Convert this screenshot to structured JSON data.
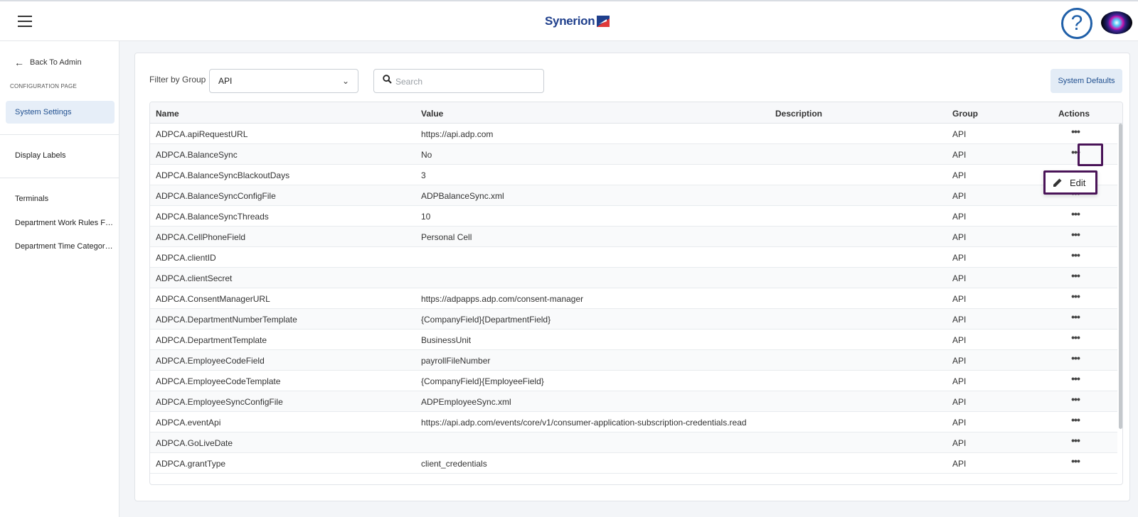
{
  "header": {
    "logo_text": "Synerion",
    "help_symbol": "?"
  },
  "sidebar": {
    "back_label": "Back To Admin",
    "section_label": "CONFIGURATION PAGE",
    "items": [
      {
        "label": "System Settings"
      },
      {
        "label": "Display Labels"
      },
      {
        "label": "Terminals"
      },
      {
        "label": "Department Work Rules Filt..."
      },
      {
        "label": "Department Time Category ..."
      }
    ]
  },
  "toolbar": {
    "filter_label": "Filter by Group",
    "filter_value": "API",
    "search_placeholder": "Search",
    "system_defaults_label": "System Defaults"
  },
  "table": {
    "columns": [
      "Name",
      "Value",
      "Description",
      "Group",
      "Actions"
    ],
    "rows": [
      {
        "name": "ADPCA.apiRequestURL",
        "value": "https://api.adp.com",
        "description": "",
        "group": "API"
      },
      {
        "name": "ADPCA.BalanceSync",
        "value": "No",
        "description": "",
        "group": "API"
      },
      {
        "name": "ADPCA.BalanceSyncBlackoutDays",
        "value": "3",
        "description": "",
        "group": "API"
      },
      {
        "name": "ADPCA.BalanceSyncConfigFile",
        "value": "ADPBalanceSync.xml",
        "description": "",
        "group": "API"
      },
      {
        "name": "ADPCA.BalanceSyncThreads",
        "value": "10",
        "description": "",
        "group": "API"
      },
      {
        "name": "ADPCA.CellPhoneField",
        "value": "Personal Cell",
        "description": "",
        "group": "API"
      },
      {
        "name": "ADPCA.clientID",
        "value": "",
        "description": "",
        "group": "API"
      },
      {
        "name": "ADPCA.clientSecret",
        "value": "",
        "description": "",
        "group": "API"
      },
      {
        "name": "ADPCA.ConsentManagerURL",
        "value": "https://adpapps.adp.com/consent-manager",
        "description": "",
        "group": "API"
      },
      {
        "name": "ADPCA.DepartmentNumberTemplate",
        "value": "{CompanyField}{DepartmentField}",
        "description": "",
        "group": "API"
      },
      {
        "name": "ADPCA.DepartmentTemplate",
        "value": "BusinessUnit",
        "description": "",
        "group": "API"
      },
      {
        "name": "ADPCA.EmployeeCodeField",
        "value": "payrollFileNumber",
        "description": "",
        "group": "API"
      },
      {
        "name": "ADPCA.EmployeeCodeTemplate",
        "value": "{CompanyField}{EmployeeField}",
        "description": "",
        "group": "API"
      },
      {
        "name": "ADPCA.EmployeeSyncConfigFile",
        "value": "ADPEmployeeSync.xml",
        "description": "",
        "group": "API"
      },
      {
        "name": "ADPCA.eventApi",
        "value": "https://api.adp.com/events/core/v1/consumer-application-subscription-credentials.read",
        "description": "",
        "group": "API"
      },
      {
        "name": "ADPCA.GoLiveDate",
        "value": "",
        "description": "",
        "group": "API"
      },
      {
        "name": "ADPCA.grantType",
        "value": "client_credentials",
        "description": "",
        "group": "API"
      }
    ],
    "action_glyph": "•••"
  },
  "context_menu": {
    "edit_label": "Edit"
  },
  "colors": {
    "brand": "#1f3f8c",
    "highlight": "#4a1458",
    "active_nav": "#e6eef8"
  }
}
